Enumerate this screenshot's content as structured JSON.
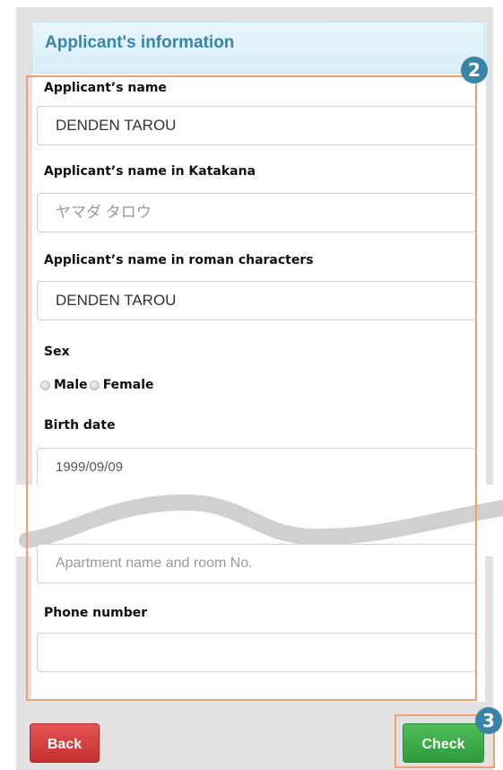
{
  "card": {
    "title": "Applicant's information"
  },
  "badges": {
    "form": "2",
    "check": "3"
  },
  "fields": {
    "name": {
      "label": "Applicant’s name",
      "value": "DENDEN TAROU"
    },
    "katakana": {
      "label": "Applicant’s name in Katakana",
      "placeholder": "ヤマダ タロウ"
    },
    "roman": {
      "label": "Applicant’s name in roman characters",
      "value": "DENDEN TAROU"
    },
    "sex": {
      "label": "Sex",
      "options": [
        "Male",
        "Female"
      ]
    },
    "birth": {
      "label": "Birth date",
      "value": "1999/09/09"
    },
    "apartment": {
      "placeholder": "Apartment name and room No."
    },
    "phone": {
      "label": "Phone number",
      "value": ""
    }
  },
  "buttons": {
    "back": "Back",
    "check": "Check"
  },
  "colors": {
    "accent": "#3a84a8",
    "highlight": "#f0a070",
    "back": "#d43b3b",
    "check": "#3aa845"
  }
}
